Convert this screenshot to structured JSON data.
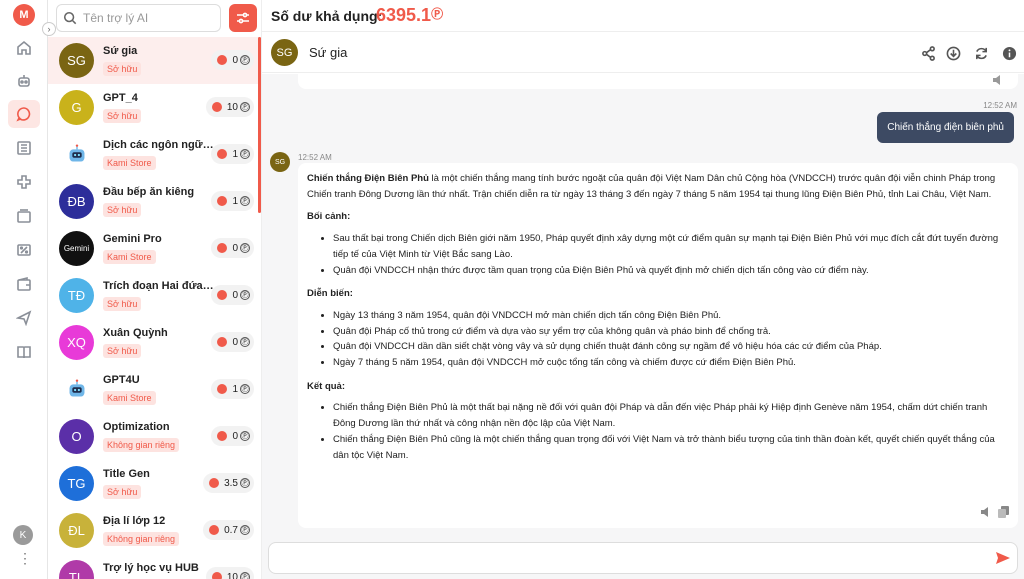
{
  "balance": {
    "label": "Số dư khả dụng:",
    "value": "6395.1",
    "unit": "Ⓟ"
  },
  "search": {
    "placeholder": "Tên trợ lý AI"
  },
  "rail": {
    "logo": "M",
    "icons": [
      "home-icon",
      "robot-icon",
      "chat-icon",
      "list-icon",
      "puzzle-icon",
      "inbox-icon",
      "discount-icon",
      "wallet-icon",
      "send-icon",
      "book-icon"
    ],
    "user_initial": "K",
    "more": "⋮"
  },
  "assistants": [
    {
      "initials": "SG",
      "name": "Sứ gia",
      "tag": "Sở hữu",
      "cost": "0",
      "color": "#7a6513",
      "active": true
    },
    {
      "initials": "G",
      "name": "GPT_4",
      "tag": "Sở hữu",
      "cost": "10",
      "color": "#c9b21b"
    },
    {
      "initials": "",
      "name": "Dịch các ngôn ngữ sa...",
      "tag": "Kami Store",
      "cost": "1",
      "color": "#ffffff",
      "robot": true
    },
    {
      "initials": "ĐB",
      "name": "Đầu bếp ăn kiêng",
      "tag": "Sở hữu",
      "cost": "1",
      "color": "#2d2e9a"
    },
    {
      "initials": "Gemini",
      "name": "Gemini Pro",
      "tag": "Kami Store",
      "cost": "0",
      "color": "#111111",
      "small": true
    },
    {
      "initials": "TĐ",
      "name": "Trích đoạn Hai đứa trẻ",
      "tag": "Sở hữu",
      "cost": "0",
      "color": "#4fb3e8"
    },
    {
      "initials": "XQ",
      "name": "Xuân Quỳnh",
      "tag": "Sở hữu",
      "cost": "0",
      "color": "#e83ad8"
    },
    {
      "initials": "",
      "name": "GPT4U",
      "tag": "Kami Store",
      "cost": "1",
      "color": "#ffffff",
      "robot": true
    },
    {
      "initials": "O",
      "name": "Optimization",
      "tag": "Không gian riêng",
      "cost": "0",
      "color": "#5b2fa8"
    },
    {
      "initials": "TG",
      "name": "Title Gen",
      "tag": "Sở hữu",
      "cost": "3.5",
      "color": "#1e6fd9"
    },
    {
      "initials": "ĐL",
      "name": "Địa lí lớp 12",
      "tag": "Không gian riêng",
      "cost": "0.7",
      "color": "#c8b23a"
    },
    {
      "initials": "TL",
      "name": "Trợ lý học vụ HUB",
      "tag": "",
      "cost": "10",
      "color": "#b03aa8"
    }
  ],
  "chat": {
    "avatar": "SG",
    "title": "Sứ gia",
    "header_icons": [
      "share-icon",
      "download-icon",
      "refresh-icon",
      "info-icon"
    ],
    "user_time": "12:52 AM",
    "user_message": "Chiến thắng điện biên phủ",
    "bot_time": "12:52 AM",
    "bot": {
      "intro_bold": "Chiến thắng Điện Biên Phủ",
      "intro_rest": " là một chiến thắng mang tính bước ngoặt của quân đội Việt Nam Dân chủ Cộng hòa (VNDCCH) trước quân đội viễn chinh Pháp trong Chiến tranh Đông Dương lần thứ nhất. Trận chiến diễn ra từ ngày 13 tháng 3 đến ngày 7 tháng 5 năm 1954 tại thung lũng Điện Biên Phủ, tỉnh Lai Châu, Việt Nam.",
      "sections": [
        {
          "heading": "Bối cảnh:",
          "bullets": [
            "Sau thất bại trong Chiến dịch Biên giới năm 1950, Pháp quyết định xây dựng một cứ điểm quân sự mạnh tại Điện Biên Phủ với mục đích cắt đứt tuyến đường tiếp tế của Việt Minh từ Việt Bắc sang Lào.",
            "Quân đội VNDCCH nhận thức được tầm quan trọng của Điện Biên Phủ và quyết định mở chiến dịch tấn công vào cứ điểm này."
          ]
        },
        {
          "heading": "Diễn biến:",
          "bullets": [
            "Ngày 13 tháng 3 năm 1954, quân đội VNDCCH mở màn chiến dịch tấn công Điện Biên Phủ.",
            "Quân đội Pháp cố thủ trong cứ điểm và dựa vào sự yểm trợ của không quân và pháo binh để chống trả.",
            "Quân đội VNDCCH dần dần siết chặt vòng vây và sử dụng chiến thuật đánh công sự ngầm để vô hiệu hóa các cứ điểm của Pháp.",
            "Ngày 7 tháng 5 năm 1954, quân đội VNDCCH mở cuộc tổng tấn công và chiếm được cứ điểm Điện Biên Phủ."
          ]
        },
        {
          "heading": "Kết quả:",
          "bullets": [
            "Chiến thắng Điện Biên Phủ là một thất bại nặng nề đối với quân đội Pháp và dẫn đến việc Pháp phải ký Hiệp định Genève năm 1954, chấm dứt chiến tranh Đông Dương lần thứ nhất và công nhận nền độc lập của Việt Nam.",
            "Chiến thắng Điện Biên Phủ cũng là một chiến thắng quan trọng đối với Việt Nam và trở thành biểu tượng của tinh thần đoàn kết, quyết chiến quyết thắng của dân tộc Việt Nam."
          ]
        }
      ]
    },
    "composer_placeholder": ""
  },
  "colors": {
    "accent": "#f05a4a",
    "user_bubble": "#3d4a63",
    "conversation_bg": "#f6f6f7"
  }
}
